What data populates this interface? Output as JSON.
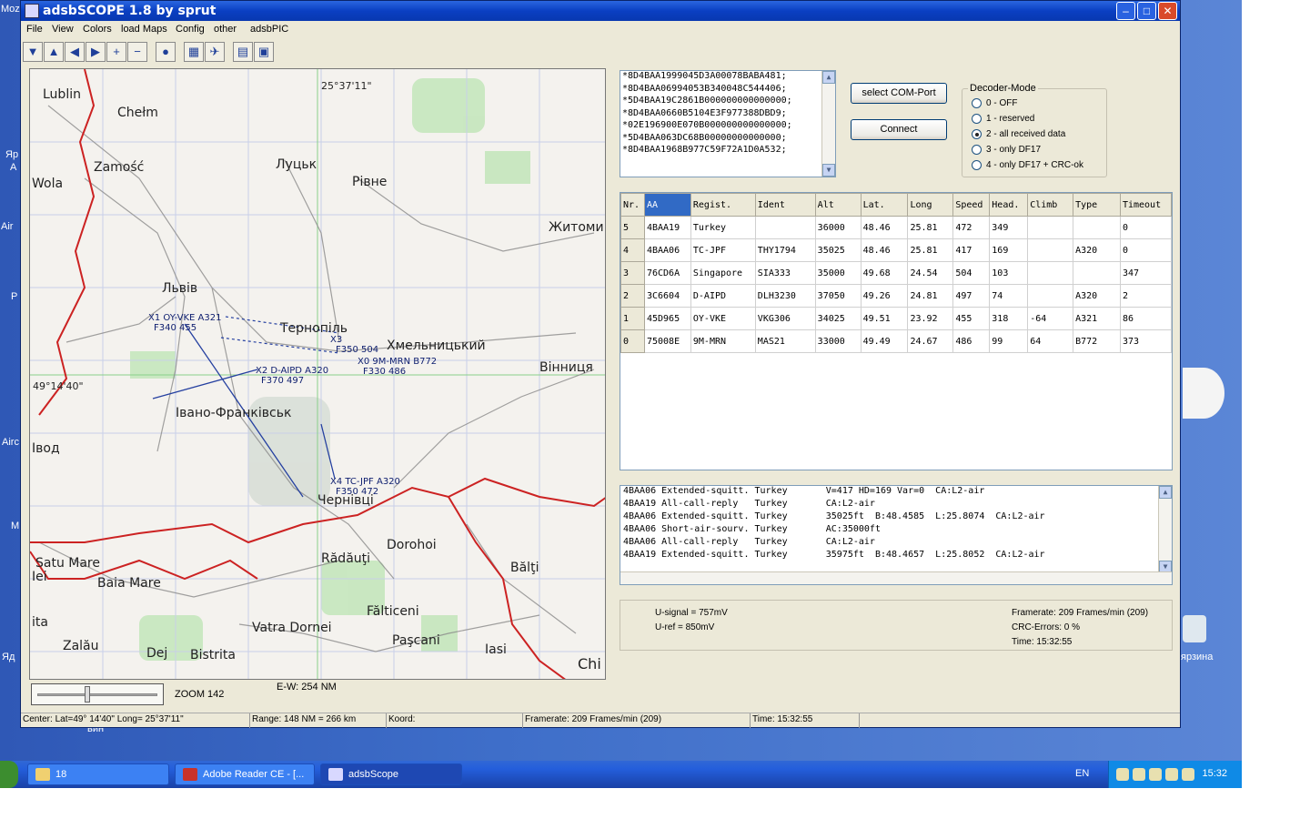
{
  "window": {
    "title": "adsbSCOPE 1.8  by sprut"
  },
  "menu": [
    "File",
    "View",
    "Colors",
    "load Maps",
    "Config",
    "other",
    "adsbPIC"
  ],
  "toolbar": {
    "icons": [
      "down-arrow-icon",
      "up-arrow-icon",
      "left-arrow-icon",
      "right-arrow-icon",
      "zoom-in-icon",
      "zoom-out-icon",
      "globe-icon",
      "airports-icon",
      "aircraft-icon",
      "chart-icon",
      "screen-icon"
    ]
  },
  "map": {
    "top_coord": "25°37'11\"",
    "left_coord": "49°14'40\"",
    "cities": [
      {
        "name": "Lublin"
      },
      {
        "name": "Chełm"
      },
      {
        "name": "Zamość"
      },
      {
        "name": "Луцьк"
      },
      {
        "name": "Рівне"
      },
      {
        "name": "Житоми"
      },
      {
        "name": "Львів"
      },
      {
        "name": "Тернопіль"
      },
      {
        "name": "Хмельницький"
      },
      {
        "name": "Вінниця"
      },
      {
        "name": "Івано-Франківськ"
      },
      {
        "name": "Чернівці"
      },
      {
        "name": "Dorohoi"
      },
      {
        "name": "Satu Mare"
      },
      {
        "name": "Baia Mare"
      },
      {
        "name": "Rădăuţi"
      },
      {
        "name": "Bălţi"
      },
      {
        "name": "Fălticeni"
      },
      {
        "name": "Vatra Dornei"
      },
      {
        "name": "Zalău"
      },
      {
        "name": "Dej"
      },
      {
        "name": "Bistrita"
      },
      {
        "name": "Paşcani"
      },
      {
        "name": "Iasi"
      },
      {
        "name": "Chi"
      },
      {
        "name": "ita"
      },
      {
        "name": "Wola"
      },
      {
        "name": "Iвод"
      },
      {
        "name": "Iei"
      }
    ],
    "flight_labels": [
      {
        "line1": "X1 OY-VKE  A321",
        "line2": "F340 455"
      },
      {
        "line1": "X3",
        "line2": "F350 504"
      },
      {
        "line1": "X0 9M-MRN  B772",
        "line2": "F330 486"
      },
      {
        "line1": "X2 D-AIPD  A320",
        "line2": "F370 497"
      },
      {
        "line1": "X4 TC-JPF  A320",
        "line2": "F350 472"
      }
    ],
    "zoom_label": "ZOOM 142",
    "ew_label": "E-W: 254 NM"
  },
  "status": {
    "center": "Center: Lat=49° 14'40\" Long= 25°37'11\"",
    "range": "Range: 148 NM = 266 km",
    "koord": "Koord:",
    "framerate": "Framerate:  209 Frames/min (209)",
    "time": "Time: 15:32:55"
  },
  "raw_messages": [
    "*8D4BAA1999045D3A00078BABA481;",
    "*8D4BAA06994053B340048C544406;",
    "*5D4BAA19C2861B000000000000000;",
    "*8D4BAA0660B5104E3F977388DBD9;",
    "*02E196900E070B000000000000000;",
    "*5D4BAA063DC68B00000000000000;",
    "*8D4BAA1968B977C59F72A1D0A532;"
  ],
  "buttons": {
    "select_com": "select COM-Port",
    "connect": "Connect"
  },
  "decoder": {
    "title": "Decoder-Mode",
    "options": [
      "0 - OFF",
      "1 - reserved",
      "2 - all received data",
      "3 - only DF17",
      "4 - only DF17 + CRC-ok"
    ],
    "selected": 2
  },
  "table": {
    "headers": [
      "Nr.",
      "AA",
      "Regist.",
      "Ident",
      "Alt",
      "Lat.",
      "Long",
      "Speed",
      "Head.",
      "Climb",
      "Type",
      "Timeout"
    ],
    "rows": [
      [
        "5",
        "4BAA19",
        "Turkey",
        "",
        "36000",
        "48.46",
        "25.81",
        "472",
        "349",
        "",
        "",
        "0"
      ],
      [
        "4",
        "4BAA06",
        "TC-JPF",
        "THY1794",
        "35025",
        "48.46",
        "25.81",
        "417",
        "169",
        "",
        "A320",
        "0"
      ],
      [
        "3",
        "76CD6A",
        "Singapore",
        "SIA333",
        "35000",
        "49.68",
        "24.54",
        "504",
        "103",
        "",
        "",
        "347"
      ],
      [
        "2",
        "3C6604",
        "D-AIPD",
        "DLH3230",
        "37050",
        "49.26",
        "24.81",
        "497",
        "74",
        "",
        "A320",
        "2"
      ],
      [
        "1",
        "45D965",
        "OY-VKE",
        "VKG306",
        "34025",
        "49.51",
        "23.92",
        "455",
        "318",
        "-64",
        "A321",
        "86"
      ],
      [
        "0",
        "75008E",
        "9M-MRN",
        "MAS21",
        "33000",
        "49.49",
        "24.67",
        "486",
        "99",
        "64",
        "B772",
        "373"
      ]
    ]
  },
  "log": [
    "4BAA06 Extended-squitt. Turkey       V=417 HD=169 Var=0  CA:L2-air",
    "4BAA19 All-call-reply   Turkey       CA:L2-air",
    "4BAA06 Extended-squitt. Turkey       35025ft  B:48.4585  L:25.8074  CA:L2-air",
    "4BAA06 Short-air-sourv. Turkey       AC:35000ft",
    "4BAA06 All-call-reply   Turkey       CA:L2-air",
    "4BAA19 Extended-squitt. Turkey       35975ft  B:48.4657  L:25.8052  CA:L2-air"
  ],
  "info": {
    "u_signal": "U-signal = 757mV",
    "u_ref": "U-ref = 850mV",
    "framerate": "Framerate:  209 Frames/min (209)",
    "crc": "CRC-Errors: 0 %",
    "time": "Time: 15:32:55"
  },
  "taskbar": {
    "items": [
      "18",
      "Adobe Reader CE - [...",
      "adsbScope"
    ],
    "lang": "EN",
    "clock": "15:32"
  },
  "desktop": {
    "labels": [
      "Moz",
      "Яр",
      "A",
      "Air",
      "P",
      "Airc",
      "M",
      "Яд",
      "вин",
      "ярзина"
    ]
  }
}
